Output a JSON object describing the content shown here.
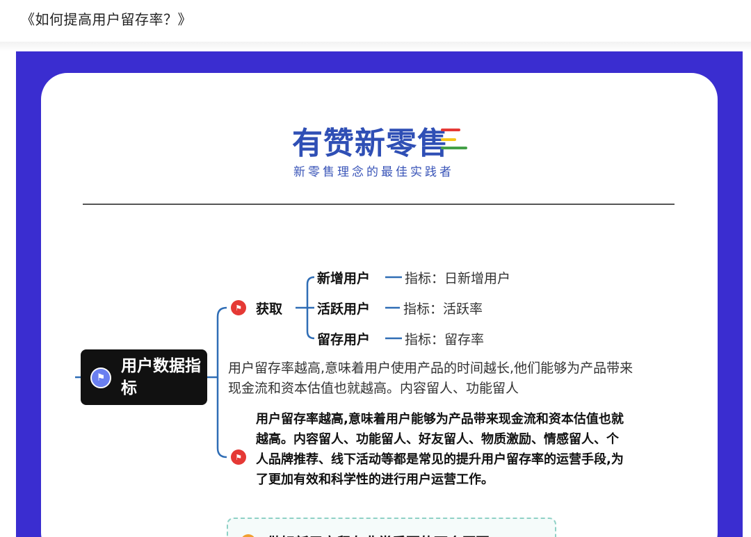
{
  "header": {
    "title": "《如何提高用户留存率？》"
  },
  "brand": {
    "name": "有赞新零售",
    "tagline": "新零售理念的最佳实践者",
    "bar_colors": [
      "#e53935",
      "#f5c518",
      "#43a047"
    ]
  },
  "mindmap": {
    "root": "用户数据指标",
    "branches": [
      {
        "label": "获取",
        "children": [
          {
            "label": "新增用户",
            "metric": "指标：日新增用户"
          },
          {
            "label": "活跃用户",
            "metric": "指标：活跃率"
          },
          {
            "label": "留存用户",
            "metric": "指标：留存率"
          }
        ]
      }
    ],
    "paragraph": "用户留存率越高,意味着用户使用产品的时间越长,他们能够为产品带来现金流和资本估值也就越高。内容留人、功能留人",
    "bold_paragraph": "用户留存率越高,意味着用户能够为产品带来现金流和资本估值也就越高。内容留人、功能留人、好友留人、物质激励、情感留人、个人品牌推荐、线下活动等都是常见的提升用户留存率的运营手段,为了更加有效和科学性的进行用户运营工作。",
    "bottom_box": "做好新用户留存非常重要的两个原因"
  },
  "colors": {
    "frame": "#3a2dd0",
    "line": "#2f6db5",
    "flag": "#e53935"
  }
}
